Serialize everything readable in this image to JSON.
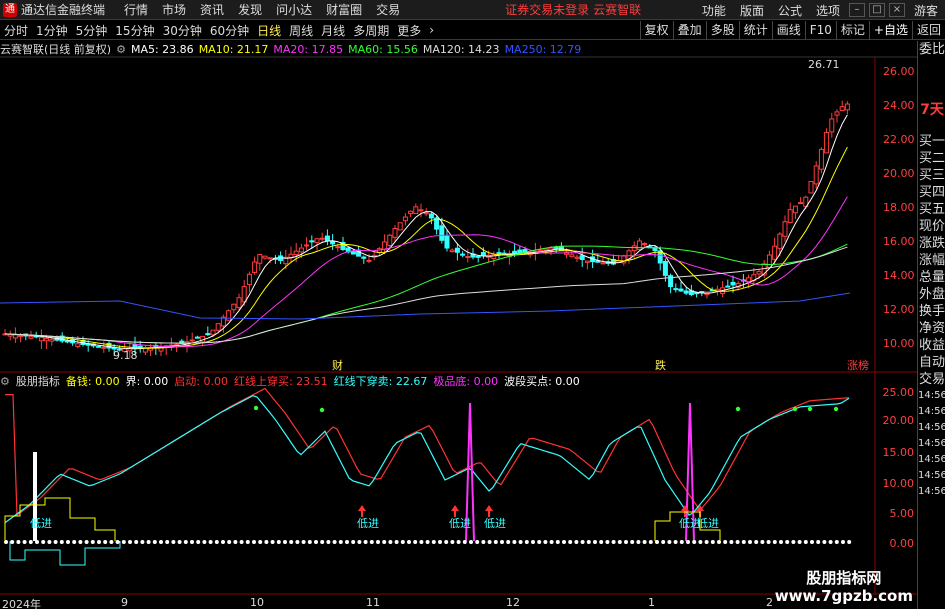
{
  "menu": {
    "title": "通达信金融终端",
    "items": [
      "行情",
      "市场",
      "资讯",
      "发现",
      "问小达",
      "财富圈",
      "交易"
    ],
    "notice": "证券交易未登录",
    "notice2": "云赛智联",
    "right_items": [
      "功能",
      "版面",
      "公式",
      "选项"
    ],
    "guest": "游客"
  },
  "periods": {
    "items": [
      "分时",
      "1分钟",
      "5分钟",
      "15分钟",
      "30分钟",
      "60分钟",
      "日线",
      "周线",
      "月线",
      "多周期",
      "更多"
    ],
    "active": "日线",
    "tools": [
      "复权",
      "叠加",
      "多股",
      "统计",
      "画线",
      "F10",
      "标记",
      "+自选",
      "返回"
    ]
  },
  "main_chart": {
    "stock": "云赛智联(日线 前复权)",
    "ma": [
      {
        "label": "MA5: 23.86",
        "color": "#ffffff"
      },
      {
        "label": "MA10: 21.17",
        "color": "#ffff00"
      },
      {
        "label": "MA20: 17.85",
        "color": "#ff33ff"
      },
      {
        "label": "MA60: 15.56",
        "color": "#33ff33"
      },
      {
        "label": "MA120: 14.23",
        "color": "#dddddd"
      },
      {
        "label": "MA250: 12.79",
        "color": "#3355ff"
      }
    ],
    "y_ticks": [
      "26.00",
      "24.00",
      "22.00",
      "20.00",
      "18.00",
      "16.00",
      "14.00",
      "12.00",
      "10.00"
    ],
    "high_label": "26.71",
    "low_label": "9.18",
    "markers": [
      "财",
      "跌",
      "涨榜"
    ]
  },
  "sub_chart": {
    "title": "股朋指标",
    "fields": [
      {
        "label": "备钱: 0.00",
        "color": "#ffff00"
      },
      {
        "label": "界: 0.00",
        "color": "#ffffff"
      },
      {
        "label": "启动: 0.00",
        "color": "#ff3333"
      },
      {
        "label": "红线上穿买: 23.51",
        "color": "#ff3333"
      },
      {
        "label": "红线下穿卖: 22.67",
        "color": "#33ffff"
      },
      {
        "label": "极品底: 0.00",
        "color": "#ff33ff"
      },
      {
        "label": "波段买点: 0.00",
        "color": "#ffffff"
      }
    ],
    "y_ticks": [
      "25.00",
      "20.00",
      "15.00",
      "10.00",
      "5.00",
      "0.00"
    ],
    "annotations": [
      "低进",
      "低进",
      "低进",
      "低进",
      "低进",
      "低进"
    ]
  },
  "dates": [
    "2024年",
    "9",
    "10",
    "11",
    "12",
    "1",
    "2"
  ],
  "sidebar": {
    "top": "委比",
    "badge": "7天",
    "items": [
      "买一",
      "买二",
      "买三",
      "买四",
      "买五",
      "现价",
      "涨跌",
      "涨幅",
      "总量",
      "外盘",
      "换手",
      "净资",
      "收益",
      "自动",
      "交易",
      "14:56",
      "14:56",
      "14:56",
      "14:56",
      "14:56",
      "14:56",
      "14:56"
    ]
  },
  "watermark": {
    "line1": "股朋指标网",
    "line2": "www.7gpzb.com"
  }
}
